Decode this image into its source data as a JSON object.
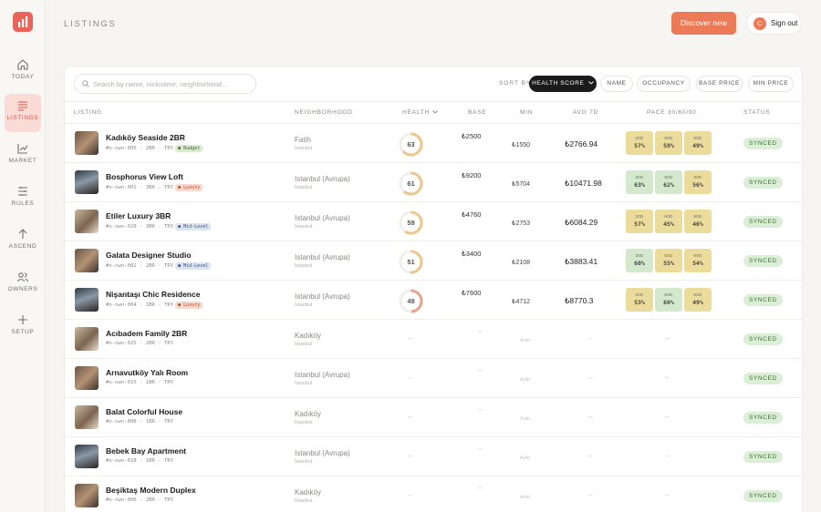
{
  "header": {
    "title": "LISTINGS",
    "discover_label": "Discover new",
    "signout_label": "Sign out",
    "avatar_initial": "C"
  },
  "sidebar": {
    "items": [
      {
        "label": "TODAY",
        "icon": "home-icon"
      },
      {
        "label": "LISTINGS",
        "icon": "list-icon",
        "active": true
      },
      {
        "label": "MARKET",
        "icon": "chart-icon"
      },
      {
        "label": "RULES",
        "icon": "rules-icon"
      },
      {
        "label": "ASCEND",
        "icon": "arrow-up-icon"
      },
      {
        "label": "OWNERS",
        "icon": "users-icon"
      },
      {
        "label": "SETUP",
        "icon": "plus-icon"
      }
    ]
  },
  "toolbar": {
    "search_placeholder": "Search by name, nickname, neighborhood…",
    "sort_by_label": "SORT BY",
    "sort_options": [
      "HEALTH SCORE",
      "NAME",
      "OCCUPANCY",
      "BASE PRICE",
      "MIN PRICE"
    ],
    "active_sort": "HEALTH SCORE"
  },
  "table": {
    "columns": [
      "LISTING",
      "NEIGHBORHOOD",
      "HEALTH",
      "BASE",
      "MIN",
      "AVG 7D",
      "PACE 30/60/90",
      "STATUS"
    ],
    "rows": [
      {
        "name": "Kadıköy Seaside 2BR",
        "meta": "#o-own-005 · 2BR · TRY",
        "tier": "Budget",
        "neighborhood": "Fatih",
        "city": "İstanbul",
        "health": 63,
        "base": "₺2500",
        "min": "₺1550",
        "avg": "₺2766.94",
        "pace": [
          "57%",
          "58%",
          "49%"
        ],
        "pace_colors": [
          "y",
          "y",
          "y"
        ],
        "status": "SYNCED"
      },
      {
        "name": "Bosphorus View Loft",
        "meta": "#o-own-001 · 3BR · TRY",
        "tier": "Luxury",
        "neighborhood": "Istanbul (Avrupa)",
        "city": "İstanbul",
        "health": 61,
        "base": "₺9200",
        "min": "₺5704",
        "avg": "₺10471.98",
        "pace": [
          "63%",
          "62%",
          "56%"
        ],
        "pace_colors": [
          "g",
          "g",
          "y"
        ],
        "status": "SYNCED"
      },
      {
        "name": "Etiler Luxury 3BR",
        "meta": "#o-own-020 · 3BR · TRY",
        "tier": "Mid-Level",
        "neighborhood": "Istanbul (Avrupa)",
        "city": "İstanbul",
        "health": 59,
        "base": "₺4760",
        "min": "₺2753",
        "avg": "₺6084.29",
        "pace": [
          "57%",
          "45%",
          "46%"
        ],
        "pace_colors": [
          "y",
          "y",
          "y"
        ],
        "status": "SYNCED"
      },
      {
        "name": "Galata Designer Studio",
        "meta": "#o-own-002 · 2BR · TRY",
        "tier": "Mid-Level",
        "neighborhood": "Istanbul (Avrupa)",
        "city": "İstanbul",
        "health": 51,
        "base": "₺3400",
        "min": "₺2108",
        "avg": "₺3883.41",
        "pace": [
          "60%",
          "55%",
          "54%"
        ],
        "pace_colors": [
          "g",
          "y",
          "y"
        ],
        "status": "SYNCED"
      },
      {
        "name": "Nişantaşı Chic Residence",
        "meta": "#o-own-004 · 1BR · TRY",
        "tier": "Luxury",
        "neighborhood": "Istanbul (Avrupa)",
        "city": "İstanbul",
        "health": 49,
        "base": "₺7600",
        "min": "₺4712",
        "avg": "₺8770.3",
        "pace": [
          "53%",
          "60%",
          "49%"
        ],
        "pace_colors": [
          "y",
          "g",
          "y"
        ],
        "status": "SYNCED"
      },
      {
        "name": "Acıbadem Family 2BR",
        "meta": "#o-own-025 · 2BR · TRY",
        "neighborhood": "Kadıköy",
        "city": "İstanbul",
        "status": "SYNCED"
      },
      {
        "name": "Arnavutköy Yalı Room",
        "meta": "#o-own-015 · 1BR · TRY",
        "neighborhood": "Istanbul (Avrupa)",
        "city": "İstanbul",
        "status": "SYNCED"
      },
      {
        "name": "Balat Colorful House",
        "meta": "#o-own-008 · 1BR · TRY",
        "neighborhood": "Kadıköy",
        "city": "İstanbul",
        "status": "SYNCED"
      },
      {
        "name": "Bebek Bay Apartment",
        "meta": "#o-own-018 · 1BR · TRY",
        "neighborhood": "Istanbul (Avrupa)",
        "city": "İstanbul",
        "status": "SYNCED"
      },
      {
        "name": "Beşiktaş Modern Duplex",
        "meta": "#o-own-006 · 2BR · TRY",
        "neighborhood": "Kadıköy",
        "city": "İstanbul",
        "status": "SYNCED"
      }
    ],
    "empty_value": "--",
    "auto_label": "Auto",
    "pace_labels": [
      "30D",
      "60D",
      "90D"
    ]
  },
  "colors": {
    "accent": "#ec7a57",
    "active_nav": "#fadcd7",
    "synced_bg": "#dbeed6",
    "pace_yellow": "#ecdc9c",
    "pace_green": "#d3e8cd"
  }
}
